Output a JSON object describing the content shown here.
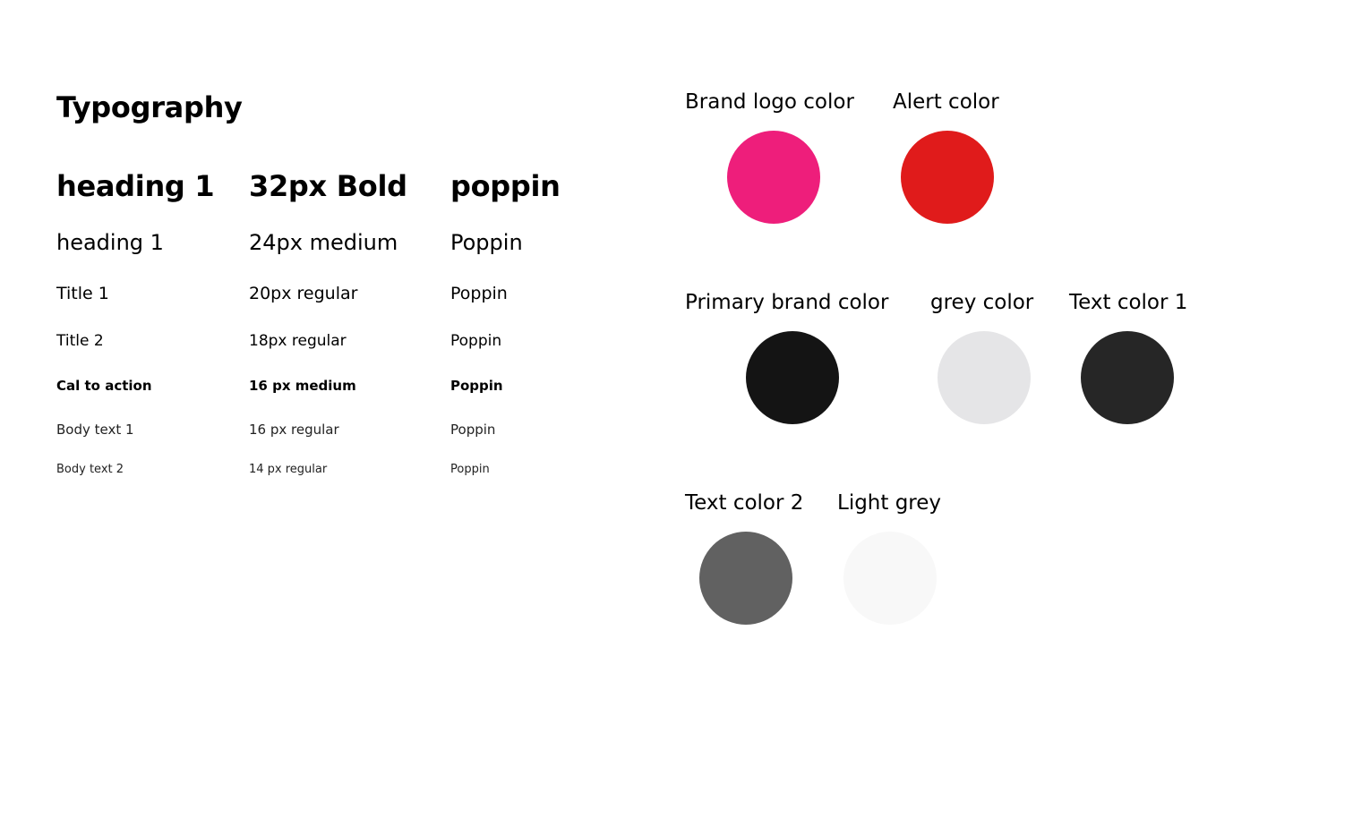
{
  "typography": {
    "title": "Typography",
    "rows": [
      {
        "name": "heading 1",
        "spec": "32px Bold",
        "font": "poppin"
      },
      {
        "name": "heading 1",
        "spec": "24px medium",
        "font": "Poppin"
      },
      {
        "name": "Title 1",
        "spec": "20px regular",
        "font": "Poppin"
      },
      {
        "name": "Title 2",
        "spec": "18px regular",
        "font": "Poppin"
      },
      {
        "name": "Cal to action",
        "spec": "16 px medium",
        "font": "Poppin"
      },
      {
        "name": "Body text 1",
        "spec": "16 px regular",
        "font": "Poppin"
      },
      {
        "name": "Body text 2",
        "spec": "14 px regular",
        "font": "Poppin"
      }
    ]
  },
  "colors": {
    "swatches": [
      {
        "label": "Brand logo color",
        "hex": "#EE1E7B"
      },
      {
        "label": "Alert color",
        "hex": "#E01B1B"
      },
      {
        "label": "Primary brand color",
        "hex": "#141414"
      },
      {
        "label": "grey color",
        "hex": "#E5E5E7"
      },
      {
        "label": "Text color 1",
        "hex": "#262626"
      },
      {
        "label": "Text color 2",
        "hex": "#616161"
      },
      {
        "label": "Light grey",
        "hex": "#F8F8F8"
      }
    ]
  }
}
